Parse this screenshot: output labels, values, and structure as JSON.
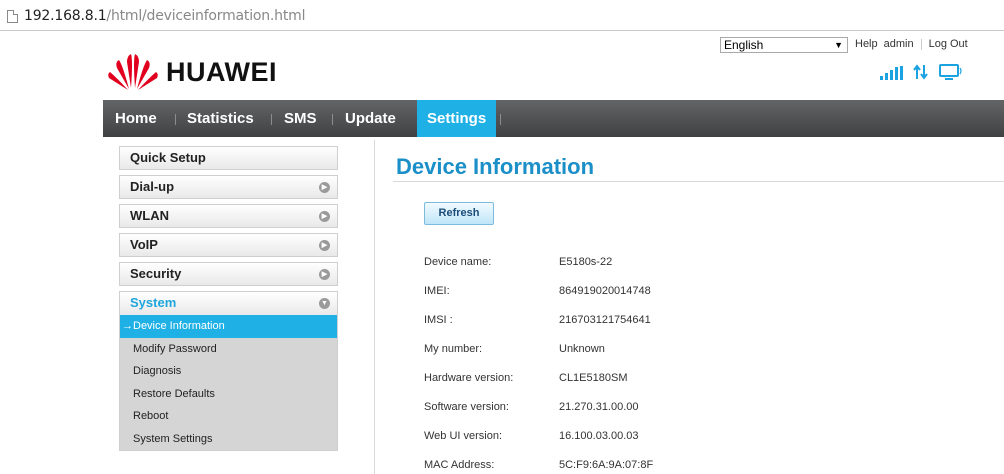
{
  "browser": {
    "url_host": "192.168.8.1",
    "url_path": "/html/deviceinformation.html"
  },
  "header": {
    "brand": "HUAWEI",
    "language": "English",
    "links": [
      "Help",
      "admin",
      "Log Out"
    ]
  },
  "nav": {
    "items": [
      "Home",
      "Statistics",
      "SMS",
      "Update",
      "Settings"
    ],
    "active": "Settings"
  },
  "sidebar": {
    "items": [
      "Quick Setup",
      "Dial-up",
      "WLAN",
      "VoIP",
      "Security",
      "System"
    ],
    "submenu": [
      "→Device Information",
      "Modify Password",
      "Diagnosis",
      "Restore Defaults",
      "Reboot",
      "System Settings"
    ]
  },
  "main": {
    "title": "Device Information",
    "refresh_label": "Refresh",
    "rows": [
      {
        "label": "Device name:",
        "value": "E5180s-22"
      },
      {
        "label": "IMEI:",
        "value": "864919020014748"
      },
      {
        "label": "IMSI :",
        "value": "216703121754641"
      },
      {
        "label": "My number:",
        "value": "Unknown"
      },
      {
        "label": "Hardware version:",
        "value": "CL1E5180SM"
      },
      {
        "label": "Software version:",
        "value": "21.270.31.00.00"
      },
      {
        "label": "Web UI version:",
        "value": "16.100.03.00.03"
      },
      {
        "label": "MAC Address:",
        "value": "5C:F9:6A:9A:07:8F"
      }
    ]
  },
  "colors": {
    "accent": "#1fb1e6",
    "title": "#1a8fc8",
    "brand_red": "#e1001e",
    "nav_bg": "#4a4c4e"
  },
  "icons": [
    "document-icon",
    "huawei-logo-icon",
    "signal-icon",
    "data-transfer-icon",
    "monitor-icon",
    "chevron-right-icon",
    "chevron-down-icon"
  ]
}
